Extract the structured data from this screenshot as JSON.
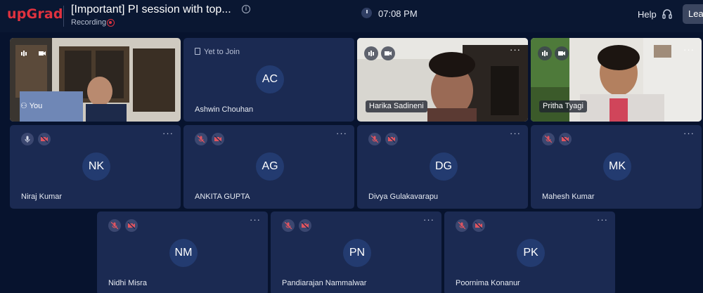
{
  "header": {
    "logo": "upGrad",
    "title": "[Important] PI session with top...",
    "recording_label": "Recording",
    "time": "07:08 PM",
    "help_label": "Help",
    "leave_label": "Lea"
  },
  "tiles": {
    "you": {
      "label": "You"
    },
    "ashwin": {
      "status": "Yet to Join",
      "initials": "AC",
      "name": "Ashwin Chouhan"
    },
    "harika": {
      "name": "Harika Sadineni",
      "more": "···"
    },
    "pritha": {
      "name": "Pritha Tyagi",
      "more": "···"
    },
    "niraj": {
      "initials": "NK",
      "name": "Niraj Kumar",
      "more": "···"
    },
    "ankita": {
      "initials": "AG",
      "name": "ANKITA GUPTA",
      "more": "···"
    },
    "divya": {
      "initials": "DG",
      "name": "Divya Gulakavarapu",
      "more": "···"
    },
    "mahesh": {
      "initials": "MK",
      "name": "Mahesh Kumar",
      "more": "···"
    },
    "nidhi": {
      "initials": "NM",
      "name": "Nidhi Misra",
      "more": "···"
    },
    "pandiarajan": {
      "initials": "PN",
      "name": "Pandiarajan Nammalwar",
      "more": "···"
    },
    "poornima": {
      "initials": "PK",
      "name": "Poornima Konanur",
      "more": "···"
    }
  },
  "colors": {
    "brand": "#e0323f",
    "background": "#07132e",
    "tile": "#1b2a52",
    "avatar": "#233b70"
  }
}
